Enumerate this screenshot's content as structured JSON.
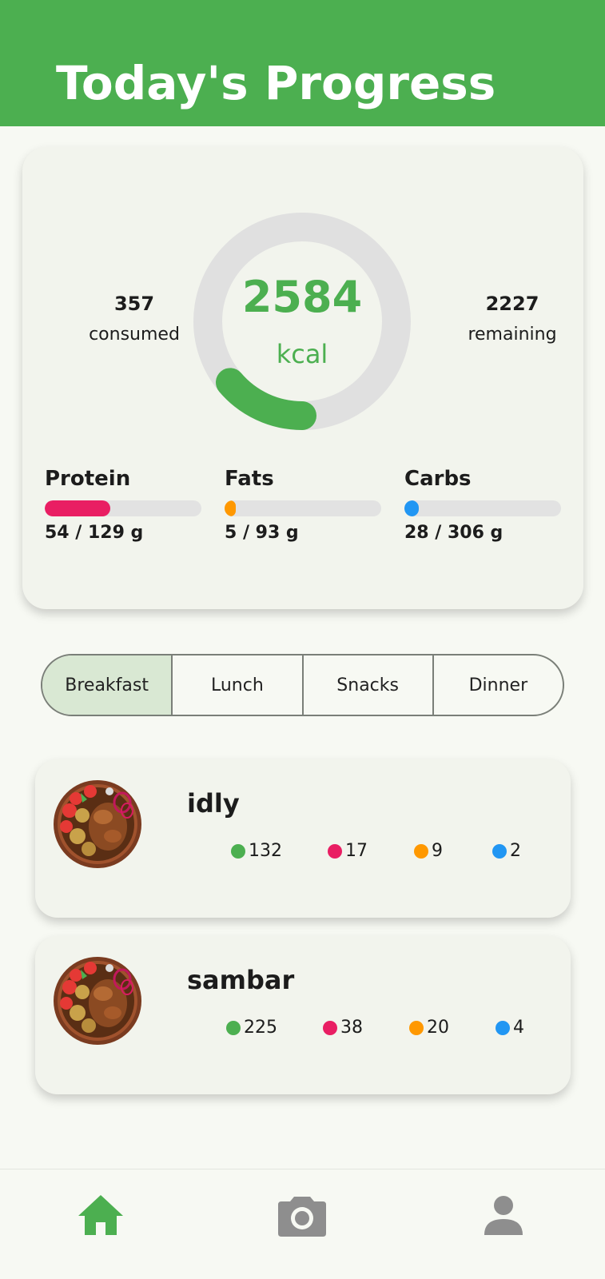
{
  "header": {
    "title": "Today's Progress"
  },
  "summary": {
    "consumed_value": "357",
    "consumed_label": "consumed",
    "target_value": "2584",
    "target_unit": "kcal",
    "remaining_value": "2227",
    "remaining_label": "remaining",
    "ring_progress": 0.138,
    "ring_color": "#4caf50",
    "ring_track_color": "#e0e0e0"
  },
  "macros": [
    {
      "name": "Protein",
      "amount": "54 / 129 g",
      "progress": 0.42,
      "color": "#e91e63"
    },
    {
      "name": "Fats",
      "amount": "5 / 93 g",
      "progress": 0.054,
      "color": "#ff9800"
    },
    {
      "name": "Carbs",
      "amount": "28 / 306 g",
      "progress": 0.092,
      "color": "#2196f3"
    }
  ],
  "tabs": [
    {
      "label": "Breakfast",
      "active": true
    },
    {
      "label": "Lunch",
      "active": false
    },
    {
      "label": "Snacks",
      "active": false
    },
    {
      "label": "Dinner",
      "active": false
    }
  ],
  "meals": [
    {
      "name": "idly",
      "calories": "132",
      "protein": "17",
      "fat": "9",
      "carbs": "2"
    },
    {
      "name": "sambar",
      "calories": "225",
      "protein": "38",
      "fat": "20",
      "carbs": "4"
    }
  ],
  "nutrient_colors": {
    "calories": "#4caf50",
    "protein": "#e91e63",
    "fat": "#ff9800",
    "carbs": "#2196f3"
  },
  "nav": [
    {
      "icon": "home-icon",
      "active": true,
      "color": "#4caf50"
    },
    {
      "icon": "camera-icon",
      "active": false,
      "color": "#8e8e8e"
    },
    {
      "icon": "person-icon",
      "active": false,
      "color": "#8e8e8e"
    }
  ]
}
